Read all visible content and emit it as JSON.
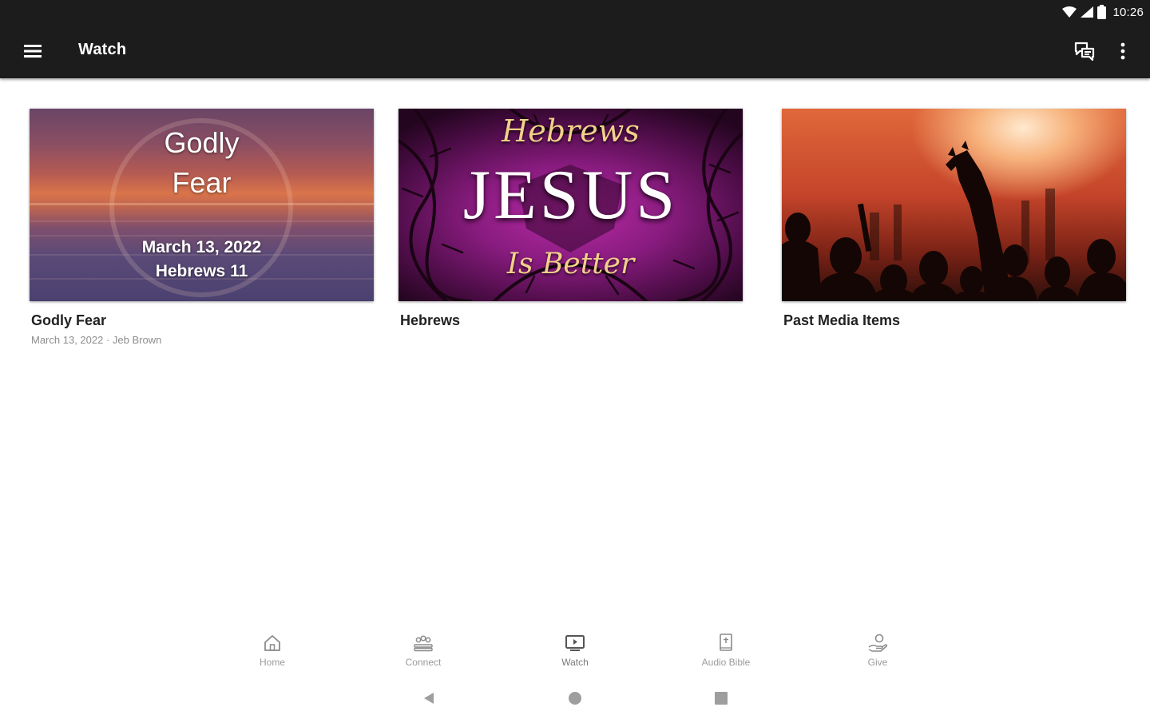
{
  "status_bar": {
    "time": "10:26"
  },
  "app_bar": {
    "title": "Watch"
  },
  "cards": [
    {
      "title": "Godly Fear",
      "subtitle": "March 13, 2022 · Jeb Brown",
      "image_lines": [
        "Godly",
        "Fear",
        "March 13, 2022",
        "Hebrews 11"
      ]
    },
    {
      "title": "Hebrews",
      "subtitle": "",
      "image_lines": [
        "Hebrews",
        "JESUS",
        "Is Better"
      ]
    },
    {
      "title": "Past Media Items",
      "subtitle": "",
      "image_lines": []
    }
  ],
  "bottom_nav": [
    {
      "label": "Home",
      "icon": "home-icon"
    },
    {
      "label": "Connect",
      "icon": "connect-icon"
    },
    {
      "label": "Watch",
      "icon": "watch-icon"
    },
    {
      "label": "Audio Bible",
      "icon": "audio-bible-icon"
    },
    {
      "label": "Give",
      "icon": "give-icon"
    }
  ],
  "colors": {
    "app_bar": "#1c1c1c",
    "nav_label": "#9a9a9a",
    "card_title": "#222222",
    "card_subtitle": "#8d8d8d"
  }
}
